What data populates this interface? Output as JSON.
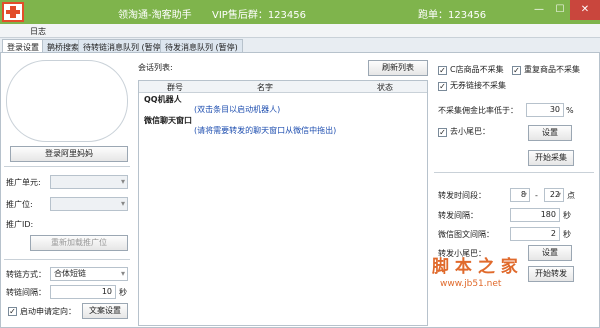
{
  "titlebar": {
    "app_title": "领淘通-淘客助手",
    "vip_group": "VIP售后群：123456",
    "member": "跑单：123456",
    "minimize": "—",
    "maximize": "☐",
    "close": "✕"
  },
  "menu": {
    "log": "日志"
  },
  "tabs": [
    "登录设置",
    "鹊桥搜索",
    "待转链消息队列 (暂停)",
    "待发消息队列 (暂停)"
  ],
  "left": {
    "login_button": "登录阿里妈妈",
    "promo_unit_label": "推广单元:",
    "promo_pos_label": "推广位:",
    "promo_id_label": "推广ID:",
    "reload_button": "重新加载推广位",
    "convert_mode_label": "转链方式：",
    "convert_mode_value": "合体短链",
    "convert_interval_label": "转链间隔：",
    "convert_interval_value": "10",
    "convert_interval_unit": "秒",
    "auto_apply_label": "启动申请定向：",
    "auto_apply_checked": true,
    "copy_settings_button": "文案设置"
  },
  "center": {
    "session_list_label": "会话列表:",
    "refresh_button": "刷新列表",
    "columns": [
      "群号",
      "名字",
      "状态"
    ],
    "rows": [
      {
        "group": "QQ机器人",
        "hint": "(双击条目以启动机器人)"
      },
      {
        "group": "微信聊天窗口",
        "hint": "(请将需要转发的聊天窗口从微信中拖出)"
      }
    ]
  },
  "right": {
    "c_store_label": "C店商品不采集",
    "c_store_checked": true,
    "dup_label": "重复商品不采集",
    "dup_checked": true,
    "no_coupon_label": "无券链接不采集",
    "no_coupon_checked": true,
    "min_commission_label": "不采集佣金比率低于：",
    "min_commission_value": "30",
    "min_commission_unit": "%",
    "tail_label": "去小尾巴：",
    "tail_checked": true,
    "settings_button": "设置",
    "start_button": "开始采集",
    "forward_time_label": "转发时间段：",
    "forward_time_from": "8",
    "forward_time_dash": "-",
    "forward_time_to": "22",
    "forward_time_unit": "点",
    "forward_interval_label": "转发间隔：",
    "forward_interval_value": "180",
    "forward_interval_unit": "秒",
    "wechat_interval_label": "微信图文间隔：",
    "wechat_interval_value": "2",
    "wechat_interval_unit": "秒",
    "add_tail_label": "转发小尾巴：",
    "add_tail_button": "设置",
    "start_forward_button": "开始转发"
  },
  "watermark": {
    "brand": "脚 本 之 家",
    "url": "www.jb51.net"
  },
  "colors": {
    "titlebar": "#7fb44c",
    "close": "#c9463d",
    "link_blue": "#1f4fb0",
    "watermark": "#e06a2c"
  }
}
